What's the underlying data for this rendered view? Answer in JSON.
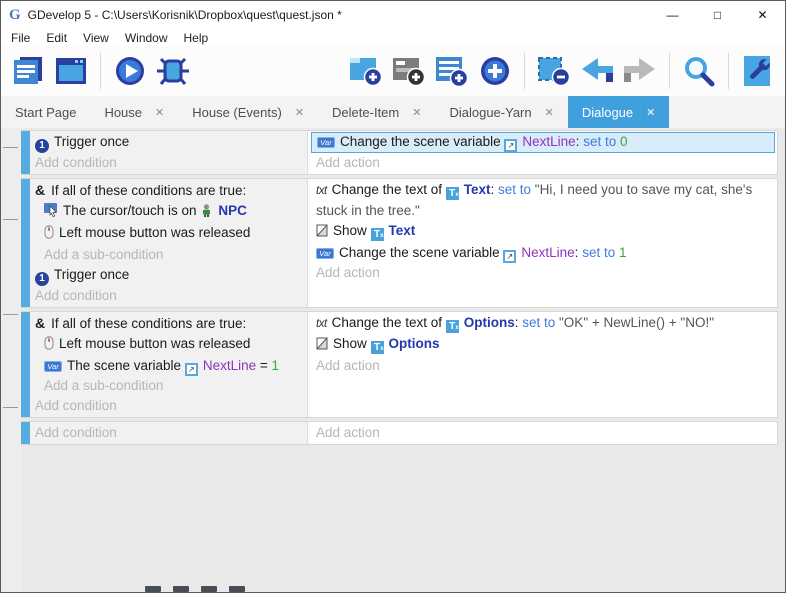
{
  "window": {
    "title": "GDevelop 5 - C:\\Users\\Korisnik\\Dropbox\\quest\\quest.json *",
    "minimize_glyph": "—",
    "maximize_glyph": "□",
    "close_glyph": "✕"
  },
  "menu": {
    "items": [
      "File",
      "Edit",
      "View",
      "Window",
      "Help"
    ]
  },
  "toolbar": {
    "buttons_left": [
      "project-manager",
      "scene-editor",
      "preview-play",
      "debug"
    ],
    "buttons_right": [
      "add-event",
      "add-sub-event",
      "add-comment",
      "add-more",
      "delete-selection",
      "undo",
      "redo",
      "search",
      "preferences"
    ]
  },
  "tabs": {
    "close_glyph": "✕",
    "items": [
      {
        "label": "Start Page",
        "closable": false,
        "active": false
      },
      {
        "label": "House",
        "closable": true,
        "active": false
      },
      {
        "label": "House (Events)",
        "closable": true,
        "active": false
      },
      {
        "label": "Delete-Item",
        "closable": true,
        "active": false
      },
      {
        "label": "Dialogue-Yarn",
        "closable": true,
        "active": false
      },
      {
        "label": "Dialogue",
        "closable": true,
        "active": true
      }
    ]
  },
  "icons": {
    "logo": "G",
    "trigger_once": "1",
    "and": "&",
    "var_chip": "Var",
    "txt": "txt",
    "text_object": "T",
    "scene_var": "↗"
  },
  "events": {
    "e1": {
      "c_trigger": "Trigger once",
      "c_add": "Add condition",
      "a_var": {
        "pre": "Change the scene variable ",
        "name": "NextLine",
        "sep": ": ",
        "op": "set to ",
        "val": "0"
      },
      "a_add": "Add action"
    },
    "e2": {
      "c_if": "If all of these conditions are true:",
      "c_cursor": {
        "pre": "The cursor/touch is on ",
        "obj": "NPC"
      },
      "c_mouse": "Left mouse button was released",
      "c_addsub": "Add a sub-condition",
      "c_trigger": "Trigger once",
      "c_add": "Add condition",
      "a_text": {
        "pre": "Change the text of ",
        "obj": "Text",
        "sep": ": ",
        "op": "set to ",
        "val": "\"Hi, I need you to save my cat, she's stuck in the tree.\""
      },
      "a_show": {
        "pre": "Show ",
        "obj": "Text"
      },
      "a_var": {
        "pre": "Change the scene variable ",
        "name": "NextLine",
        "sep": ": ",
        "op": "set to ",
        "val": "1"
      },
      "a_add": "Add action"
    },
    "e3": {
      "c_if": "If all of these conditions are true:",
      "c_mouse": "Left mouse button was released",
      "c_var": {
        "pre": "The scene variable ",
        "name": "NextLine",
        "sep": " = ",
        "val": "1"
      },
      "c_addsub": "Add a sub-condition",
      "c_add": "Add condition",
      "a_text": {
        "pre": "Change the text of ",
        "obj": "Options",
        "sep": ": ",
        "op": "set to ",
        "val": "\"OK\" + NewLine() + \"NO!\""
      },
      "a_show": {
        "pre": "Show ",
        "obj": "Options"
      },
      "a_add": "Add action"
    },
    "e4": {
      "c_add": "Add condition",
      "a_add": "Add action"
    }
  },
  "colors": {
    "accent_tab": "#3fa0dd",
    "event_bar": "#56ace0",
    "object_name": "#2438ad",
    "variable_name": "#9232bd",
    "operator": "#3b7de0",
    "value_number": "#3fa33f",
    "string_value": "#555555",
    "selection_bg": "#d9ecf9",
    "selection_border": "#55a5da"
  }
}
